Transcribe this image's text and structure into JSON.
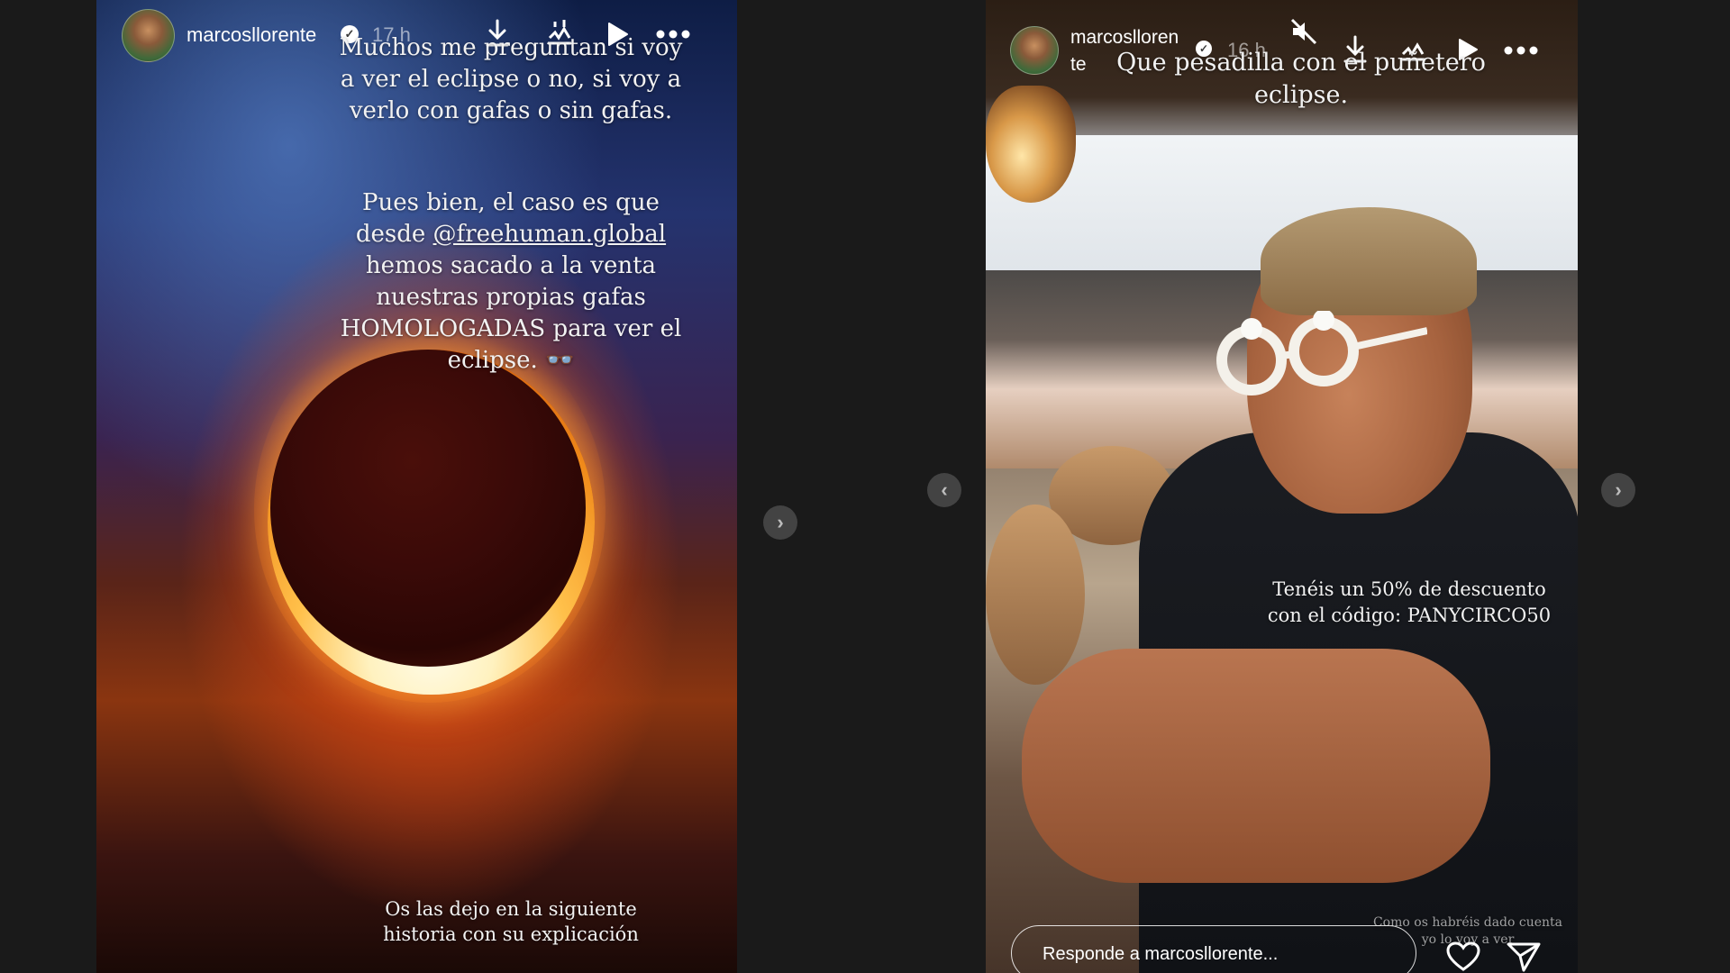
{
  "left_story": {
    "username": "marcosllorente",
    "timestamp": "17 h",
    "text_top": "Muchos me preguntan si voy\na ver el eclipse o no, si voy a\nverlo con gafas o sin gafas.",
    "text_mid_a": "Pues bien, el caso es que\ndesde ",
    "mention": "@freehuman.global",
    "text_mid_b": "\nhemos sacado a la venta\nnuestras propias gafas\nHOMOLOGADAS para ver el\neclipse. 👓",
    "text_bottom": "Os las dejo en la siguiente\nhistoria con su explicación"
  },
  "right_story": {
    "username_line1": "marcoslloren",
    "username_line2": "te",
    "timestamp": "16 h",
    "text_top": "Que pesadilla con el puñetero\neclipse.",
    "text_discount": "Tenéis un 50% de descuento\ncon el código: PANYCIRCO50",
    "text_small": "Como os habréis dado cuenta\nyo lo voy a ver",
    "reply_placeholder": "Responde a marcosllorente..."
  },
  "icons": {
    "download": "download-icon",
    "audio": "audio-icon",
    "play": "play-icon",
    "more": "more-icon",
    "muted": "muted-speaker-icon",
    "heart": "heart-icon",
    "send": "send-icon",
    "prev": "chevron-left-icon",
    "next": "chevron-right-icon",
    "verified": "verified-badge-icon"
  },
  "nav": {
    "prev": "‹",
    "next": "›"
  }
}
